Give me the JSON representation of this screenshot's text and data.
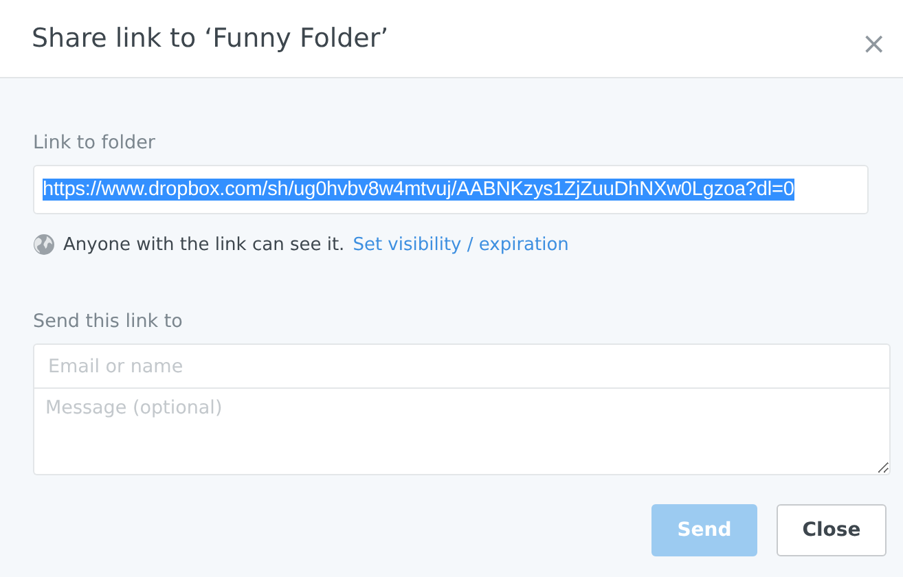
{
  "dialog": {
    "title": "Share link to ‘Funny Folder’",
    "close_icon": "×"
  },
  "link": {
    "label": "Link to folder",
    "value": "https://www.dropbox.com/sh/ug0hvbv8w4mtvuj/AABNKzys1ZjZuuDhNXw0Lgzoa?dl=0",
    "selected": true
  },
  "visibility": {
    "text": "Anyone with the link can see it.",
    "link": "Set visibility / expiration"
  },
  "send": {
    "label": "Send this link to",
    "recipient": {
      "placeholder": "Email or name"
    },
    "message": {
      "placeholder": "Message (optional)"
    }
  },
  "buttons": [
    {
      "label": "Send",
      "kind": "primary",
      "disabled": true
    },
    {
      "label": "Close",
      "kind": "secondary",
      "disabled": false
    }
  ]
}
